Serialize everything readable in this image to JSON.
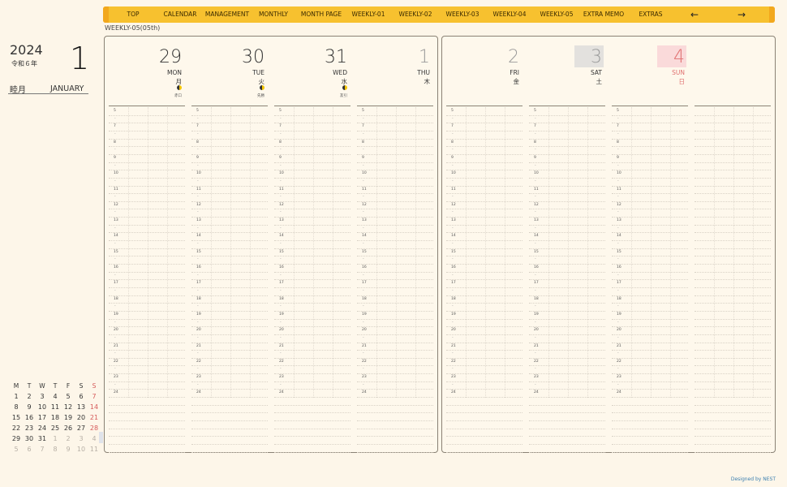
{
  "nav": {
    "items": [
      "TOP",
      "CALENDAR",
      "MANAGEMENT",
      "MONTHLY",
      "MONTH PAGE",
      "WEEKLY-01",
      "WEEKLY-02",
      "WEEKLY-03",
      "WEEKLY-04",
      "WEEKLY-05",
      "EXTRA MEMO",
      "EXTRAS"
    ],
    "prev_arrow": "←",
    "next_arrow": "→"
  },
  "week_label": "WEEKLY-05(05th)",
  "header": {
    "year": "2024",
    "era": "令和６年",
    "month_num": "1",
    "month_jp": "睦月",
    "month_en": "JANUARY"
  },
  "mini_calendar": {
    "weekdays": [
      "M",
      "T",
      "W",
      "T",
      "F",
      "S",
      "S"
    ],
    "weeks": [
      [
        "1",
        "2",
        "3",
        "4",
        "5",
        "6",
        "7"
      ],
      [
        "8",
        "9",
        "10",
        "11",
        "12",
        "13",
        "14"
      ],
      [
        "15",
        "16",
        "17",
        "18",
        "19",
        "20",
        "21"
      ],
      [
        "22",
        "23",
        "24",
        "25",
        "26",
        "27",
        "28"
      ],
      [
        "29",
        "30",
        "31",
        "1",
        "2",
        "3",
        "4"
      ],
      [
        "5",
        "6",
        "7",
        "8",
        "9",
        "10",
        "11"
      ]
    ]
  },
  "days": [
    {
      "num": "29",
      "en": "MON",
      "jp": "月",
      "rokuyo": "赤口",
      "moon": true
    },
    {
      "num": "30",
      "en": "TUE",
      "jp": "火",
      "rokuyo": "先勝",
      "moon": true
    },
    {
      "num": "31",
      "en": "WED",
      "jp": "水",
      "rokuyo": "友引",
      "moon": true
    },
    {
      "num": "1",
      "en": "THU",
      "jp": "木",
      "rokuyo": "",
      "moon": false
    },
    {
      "num": "2",
      "en": "FRI",
      "jp": "金",
      "rokuyo": "",
      "moon": false
    },
    {
      "num": "3",
      "en": "SAT",
      "jp": "土",
      "rokuyo": "",
      "moon": false
    },
    {
      "num": "4",
      "en": "SUN",
      "jp": "日",
      "rokuyo": "",
      "moon": false
    }
  ],
  "hours": [
    "5",
    "7",
    "8",
    "9",
    "10",
    "11",
    "12",
    "13",
    "14",
    "15",
    "16",
    "17",
    "18",
    "19",
    "20",
    "21",
    "22",
    "23",
    "24"
  ],
  "half_mark": "-",
  "credit": "Designed by NEST",
  "colors": {
    "nav": "#f7c12f",
    "sunday": "#e07070",
    "saturday_box": "#e3e1de",
    "sunday_box": "#fadada"
  }
}
